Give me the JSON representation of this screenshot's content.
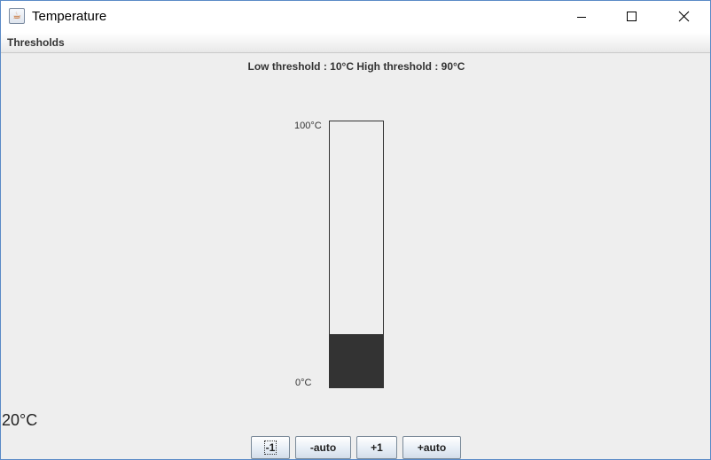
{
  "window": {
    "title": "Temperature",
    "app_icon": "java-cup-icon"
  },
  "menubar": {
    "items": [
      {
        "label": "Thresholds"
      }
    ]
  },
  "thresholds": {
    "text": "Low threshold : 10°C  High threshold : 90°C"
  },
  "gauge": {
    "max_label": "100°C",
    "min_label": "0°C",
    "min": 0,
    "max": 100,
    "value": 20,
    "fill_color": "#333333"
  },
  "current_temperature": "20°C",
  "buttons": {
    "minus_one": "-1",
    "minus_auto": "-auto",
    "plus_one": "+1",
    "plus_auto": "+auto"
  },
  "colors": {
    "window_border": "#5a8ac6",
    "background": "#eeeeee"
  }
}
